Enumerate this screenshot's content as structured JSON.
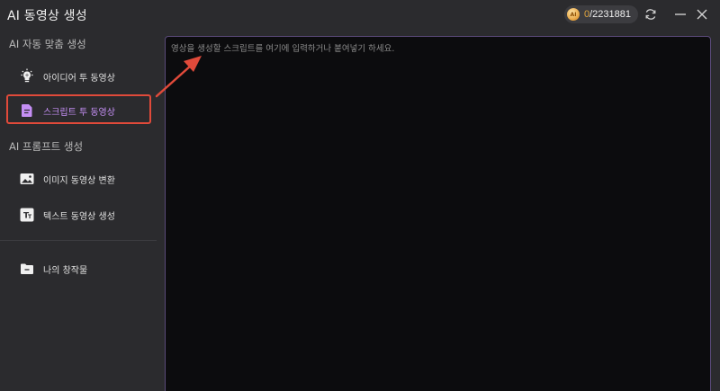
{
  "titlebar": {
    "app_title": "AI 동영상 생성",
    "credits": {
      "coin_label": "AI",
      "used": "0",
      "total": "/2231881"
    }
  },
  "sidebar": {
    "section_auto": "AI 자동 맞춤 생성",
    "section_prompt": "AI 프롬프트 생성",
    "items": [
      {
        "label": "아이디어 투 동영상",
        "icon": "lightbulb-icon"
      },
      {
        "label": "스크립트 투 동영상",
        "icon": "document-icon",
        "active": true
      },
      {
        "label": "이미지 동영상 변환",
        "icon": "image-icon"
      },
      {
        "label": "텍스트 동영상 생성",
        "icon": "text-icon"
      },
      {
        "label": "나의 창작물",
        "icon": "folder-icon"
      }
    ]
  },
  "main": {
    "script_placeholder": "영상을 생성할 스크립트를 여기에 입력하거나 붙여넣기 하세요.",
    "script_value": ""
  },
  "colors": {
    "accent_purple": "#c58ff5",
    "annotation_red": "#e04a3a",
    "coin_gold": "#e0a43c"
  }
}
